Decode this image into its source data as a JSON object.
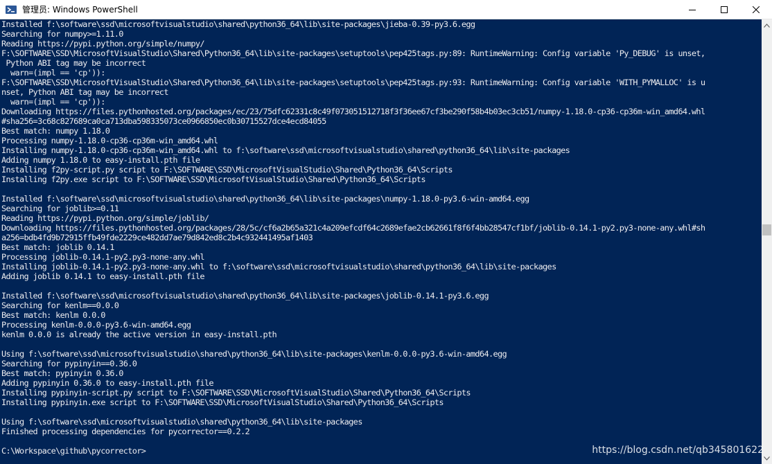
{
  "window": {
    "title": "管理员: Windows PowerShell",
    "app_icon": "powershell-icon",
    "controls": [
      "minimize-icon",
      "maximize-icon",
      "close-icon"
    ]
  },
  "terminal": {
    "background": "#012456",
    "foreground": "#eeedf0",
    "lines": [
      "Installed f:\\software\\ssd\\microsoftvisualstudio\\shared\\python36_64\\lib\\site-packages\\jieba-0.39-py3.6.egg",
      "Searching for numpy>=1.11.0",
      "Reading https://pypi.python.org/simple/numpy/",
      "F:\\SOFTWARE\\SSD\\MicrosoftVisualStudio\\Shared\\Python36_64\\lib\\site-packages\\setuptools\\pep425tags.py:89: RuntimeWarning: Config variable 'Py_DEBUG' is unset,",
      " Python ABI tag may be incorrect",
      "  warn=(impl == 'cp')):",
      "F:\\SOFTWARE\\SSD\\MicrosoftVisualStudio\\Shared\\Python36_64\\lib\\site-packages\\setuptools\\pep425tags.py:93: RuntimeWarning: Config variable 'WITH_PYMALLOC' is u",
      "nset, Python ABI tag may be incorrect",
      "  warn=(impl == 'cp')):",
      "Downloading https://files.pythonhosted.org/packages/ec/23/75dfc62331c8c49f073051512718f3f36ee67cf3be290f58b4b03ec3cb51/numpy-1.18.0-cp36-cp36m-win_amd64.whl",
      "#sha256=3c68c827689ca0ca713dba598335073ce0966850ec0b30715527dce4ecd84055",
      "Best match: numpy 1.18.0",
      "Processing numpy-1.18.0-cp36-cp36m-win_amd64.whl",
      "Installing numpy-1.18.0-cp36-cp36m-win_amd64.whl to f:\\software\\ssd\\microsoftvisualstudio\\shared\\python36_64\\lib\\site-packages",
      "Adding numpy 1.18.0 to easy-install.pth file",
      "Installing f2py-script.py script to F:\\SOFTWARE\\SSD\\MicrosoftVisualStudio\\Shared\\Python36_64\\Scripts",
      "Installing f2py.exe script to F:\\SOFTWARE\\SSD\\MicrosoftVisualStudio\\Shared\\Python36_64\\Scripts",
      "",
      "Installed f:\\software\\ssd\\microsoftvisualstudio\\shared\\python36_64\\lib\\site-packages\\numpy-1.18.0-py3.6-win-amd64.egg",
      "Searching for joblib>=0.11",
      "Reading https://pypi.python.org/simple/joblib/",
      "Downloading https://files.pythonhosted.org/packages/28/5c/cf6a2b65a321c4a209efcdf64c2689efae2cb62661f8f6f4bb28547cf1bf/joblib-0.14.1-py2.py3-none-any.whl#sh",
      "a256=bdb4fd9b72915ffb49fde2229ce482dd7ae79d842ed8c2b4c932441495af1403",
      "Best match: joblib 0.14.1",
      "Processing joblib-0.14.1-py2.py3-none-any.whl",
      "Installing joblib-0.14.1-py2.py3-none-any.whl to f:\\software\\ssd\\microsoftvisualstudio\\shared\\python36_64\\lib\\site-packages",
      "Adding joblib 0.14.1 to easy-install.pth file",
      "",
      "Installed f:\\software\\ssd\\microsoftvisualstudio\\shared\\python36_64\\lib\\site-packages\\joblib-0.14.1-py3.6.egg",
      "Searching for kenlm==0.0.0",
      "Best match: kenlm 0.0.0",
      "Processing kenlm-0.0.0-py3.6-win-amd64.egg",
      "kenlm 0.0.0 is already the active version in easy-install.pth",
      "",
      "Using f:\\software\\ssd\\microsoftvisualstudio\\shared\\python36_64\\lib\\site-packages\\kenlm-0.0.0-py3.6-win-amd64.egg",
      "Searching for pypinyin==0.36.0",
      "Best match: pypinyin 0.36.0",
      "Adding pypinyin 0.36.0 to easy-install.pth file",
      "Installing pypinyin-script.py script to F:\\SOFTWARE\\SSD\\MicrosoftVisualStudio\\Shared\\Python36_64\\Scripts",
      "Installing pypinyin.exe script to F:\\SOFTWARE\\SSD\\MicrosoftVisualStudio\\Shared\\Python36_64\\Scripts",
      "",
      "Using f:\\software\\ssd\\microsoftvisualstudio\\shared\\python36_64\\lib\\site-packages",
      "Finished processing dependencies for pycorrector==0.2.2",
      "",
      "C:\\Workspace\\github\\pycorrector>"
    ]
  },
  "watermark": "https://blog.csdn.net/qb345801622"
}
